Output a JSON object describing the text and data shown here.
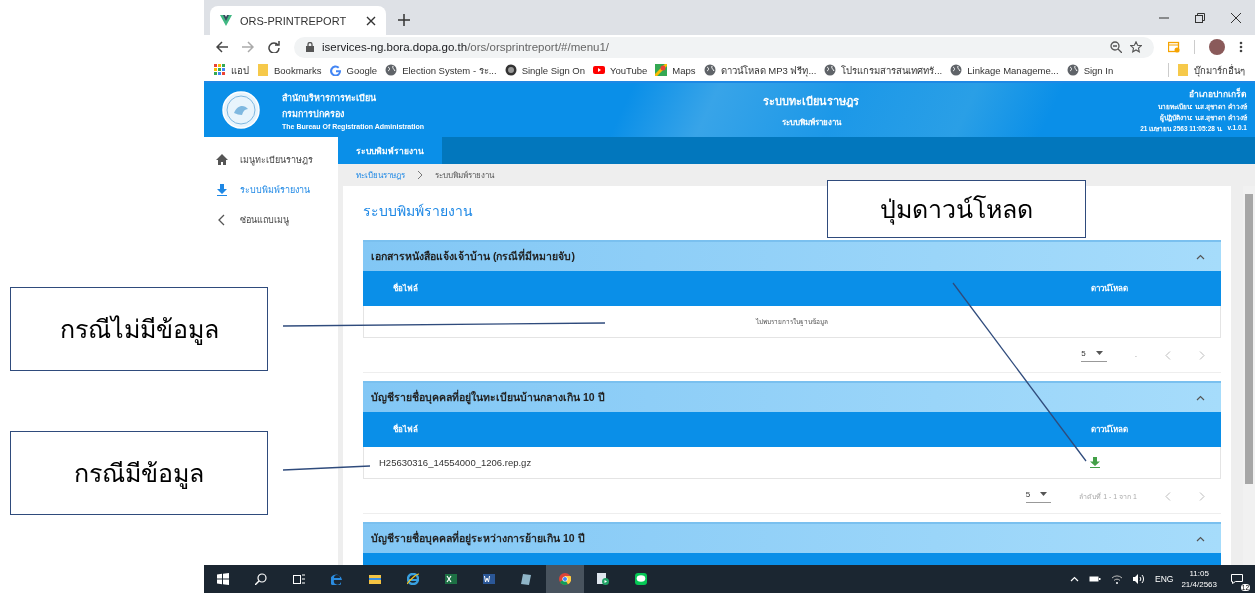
{
  "browser": {
    "tabs": [
      {
        "title": "ORS-PRINTREPORT",
        "selected": true
      }
    ],
    "url_host": "iservices-ng.bora.dopa.go.th",
    "url_path": "/ors/orsprintreport/#/menu1/",
    "bookmarks": [
      {
        "label": "แอป",
        "kind": "apps"
      },
      {
        "label": "Bookmarks",
        "kind": "folder"
      },
      {
        "label": "Google",
        "kind": "google"
      },
      {
        "label": "Election System - ระ...",
        "kind": "globe"
      },
      {
        "label": "Single Sign On",
        "kind": "badge"
      },
      {
        "label": "YouTube",
        "kind": "youtube"
      },
      {
        "label": "Maps",
        "kind": "maps"
      },
      {
        "label": "ดาวน์โหลด MP3 ฟรีทุ...",
        "kind": "globe"
      },
      {
        "label": "โปรแกรมสารสนเทศทรั...",
        "kind": "globe"
      },
      {
        "label": "Linkage Manageme...",
        "kind": "globe"
      },
      {
        "label": "Sign In",
        "kind": "globe"
      }
    ],
    "other_bookmarks": "บุ๊กมาร์กอื่นๆ"
  },
  "app_header": {
    "org_lines": [
      "สำนักบริหารการทะเบียน",
      "กรมการปกครอง",
      "The Bureau Of Registration Administration"
    ],
    "title": "ระบบทะเบียนราษฎร",
    "subtitle": "ระบบพิมพ์รายงาน",
    "info_lines": [
      "อำเภอปากเกร็ด",
      "นายทะเบียน: น.ส.สุชาดา คำวงษ์",
      "ผู้ปฏิบัติงาน: น.ส.สุชาดา คำวงษ์"
    ],
    "datetime": "21 เมษายน 2563 11:05:28 น.",
    "version": "v.1.0.1"
  },
  "sidebar": {
    "items": [
      {
        "label": "เมนูทะเบียนราษฎร",
        "selected": false
      },
      {
        "label": "ระบบพิมพ์รายงาน",
        "selected": true
      },
      {
        "label": "ซ่อนแถบเมนู",
        "selected": false
      }
    ]
  },
  "nav_tabs": [
    {
      "label": "ระบบพิมพ์รายงาน",
      "selected": true
    }
  ],
  "breadcrumb": [
    {
      "label": "ทะเบียนราษฎร",
      "kind": "link"
    },
    {
      "label": "ระบบพิมพ์รายงาน",
      "kind": "current"
    }
  ],
  "page_title": "ระบบพิมพ์รายงาน",
  "panels": [
    {
      "title": "เอกสารหนังสือแจ้งเจ้าบ้าน (กรณีที่มีหมายจับ)",
      "expanded": true,
      "columns": [
        "ชื่อไฟล์",
        "ดาวน์โหลด"
      ],
      "empty_text": "ไม่พบรายการในฐานข้อมูล",
      "page_size": "5",
      "range": "-"
    },
    {
      "title": "บัญชีรายชื่อบุคคลที่อยู่ในทะเบียนบ้านกลางเกิน 10 ปี",
      "expanded": true,
      "columns": [
        "ชื่อไฟล์",
        "ดาวน์โหลด"
      ],
      "rows": [
        {
          "file": "H25630316_14554000_1206.rep.gz"
        }
      ],
      "page_size": "5",
      "range": "ลำดับที่ 1 - 1 จาก 1"
    },
    {
      "title": "บัญชีรายชื่อบุคคลที่อยู่ระหว่างการย้ายเกิน 10 ปี",
      "expanded": true
    }
  ],
  "taskbar": {
    "apps": [
      {
        "kind": "start",
        "selected": false
      },
      {
        "kind": "search",
        "selected": false
      },
      {
        "kind": "taskview",
        "selected": false
      },
      {
        "kind": "edge",
        "selected": false
      },
      {
        "kind": "explorer",
        "selected": false
      },
      {
        "kind": "ie",
        "selected": false
      },
      {
        "kind": "excel",
        "selected": false
      },
      {
        "kind": "word",
        "selected": false
      },
      {
        "kind": "tablet",
        "selected": false
      },
      {
        "kind": "chrome",
        "selected": true
      },
      {
        "kind": "media",
        "selected": false
      },
      {
        "kind": "chat",
        "selected": false
      }
    ],
    "language": "ENG",
    "time": "11:05",
    "date": "21/4/2563",
    "notifications": "12"
  },
  "annotations": [
    {
      "text": "กรณีไม่มีข้อมูล"
    },
    {
      "text": "กรณีมีข้อมูล"
    },
    {
      "text": "ปุ่มดาวน์โหลด"
    }
  ]
}
